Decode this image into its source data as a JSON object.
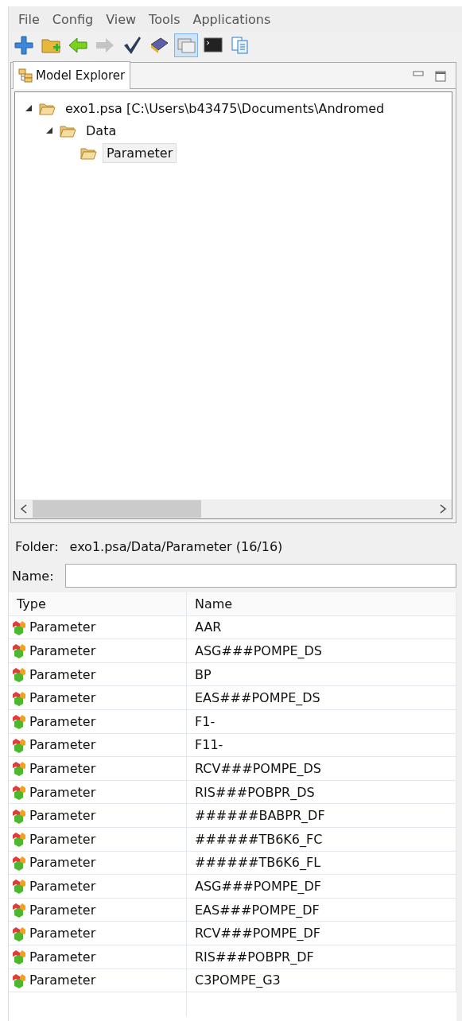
{
  "menu": [
    "File",
    "Config",
    "View",
    "Tools",
    "Applications"
  ],
  "toolbar": [
    {
      "kind": "add",
      "selected": false,
      "disabled": false
    },
    {
      "kind": "new-folder",
      "selected": false,
      "disabled": false
    },
    {
      "kind": "back",
      "selected": false,
      "disabled": false
    },
    {
      "kind": "forward",
      "selected": false,
      "disabled": true
    },
    {
      "kind": "check",
      "selected": false,
      "disabled": false
    },
    {
      "kind": "book",
      "selected": false,
      "disabled": false
    },
    {
      "kind": "window",
      "selected": true,
      "disabled": false
    },
    {
      "kind": "console",
      "selected": false,
      "disabled": false
    },
    {
      "kind": "copy",
      "selected": false,
      "disabled": false
    }
  ],
  "panel": {
    "tab": "Model Explorer",
    "tree": [
      {
        "label": "exo1.psa [C:\\Users\\b43475\\Documents\\Andromed",
        "expanded": true,
        "selected": false,
        "children": [
          {
            "label": "Data",
            "expanded": true,
            "selected": false,
            "children": [
              {
                "label": "Parameter",
                "selected": true
              }
            ]
          }
        ]
      }
    ]
  },
  "folder": {
    "label": "Folder:",
    "path": "exo1.psa/Data/Parameter (16/16)"
  },
  "filter": {
    "label": "Name:"
  },
  "table": {
    "columns": [
      "Type",
      "Name"
    ],
    "rows": [
      [
        "Parameter",
        "AAR"
      ],
      [
        "Parameter",
        "ASG###POMPE_DS"
      ],
      [
        "Parameter",
        "BP"
      ],
      [
        "Parameter",
        "EAS###POMPE_DS"
      ],
      [
        "Parameter",
        "F1-"
      ],
      [
        "Parameter",
        "F11-"
      ],
      [
        "Parameter",
        "RCV###POMPE_DS"
      ],
      [
        "Parameter",
        "RIS###POBPR_DS"
      ],
      [
        "Parameter",
        "######BABPR_DF"
      ],
      [
        "Parameter",
        "######TB6K6_FC"
      ],
      [
        "Parameter",
        "######TB6K6_FL"
      ],
      [
        "Parameter",
        "ASG###POMPE_DF"
      ],
      [
        "Parameter",
        "EAS###POMPE_DF"
      ],
      [
        "Parameter",
        "RCV###POMPE_DF"
      ],
      [
        "Parameter",
        "RIS###POBPR_DF"
      ],
      [
        "Parameter",
        "C3POMPE_G3"
      ]
    ]
  }
}
